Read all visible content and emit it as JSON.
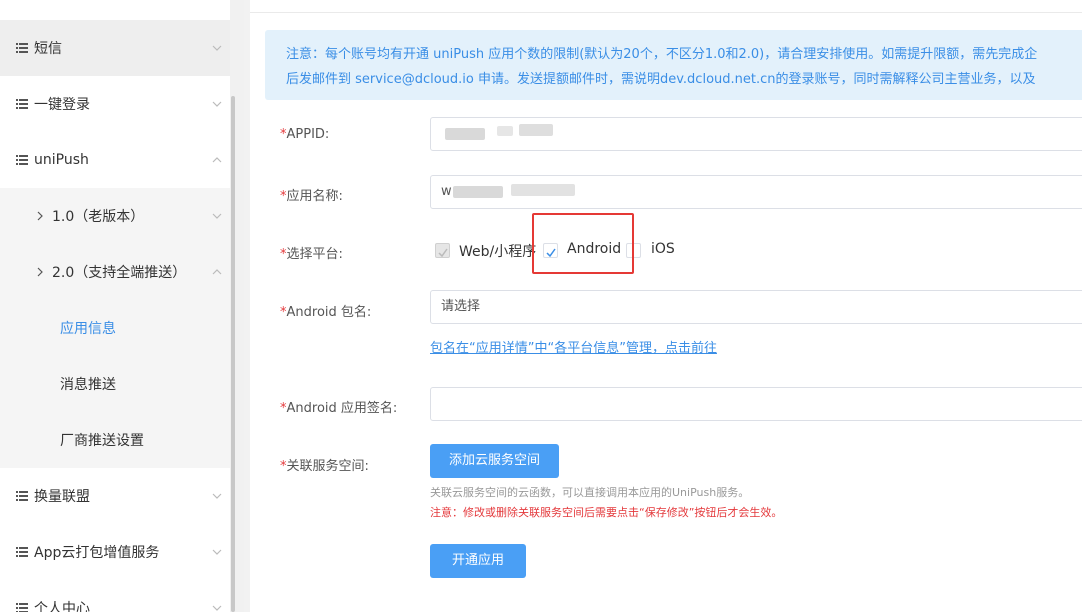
{
  "sidebar": {
    "items": [
      {
        "label": "短信",
        "expanded": false
      },
      {
        "label": "一键登录",
        "expanded": false
      },
      {
        "label": "uniPush",
        "expanded": true
      },
      {
        "label": "1.0（老版本）",
        "expanded": false
      },
      {
        "label": "2.0（支持全端推送）",
        "expanded": true
      },
      {
        "label": "应用信息",
        "active": true
      },
      {
        "label": "消息推送"
      },
      {
        "label": "厂商推送设置"
      },
      {
        "label": "换量联盟",
        "expanded": false
      },
      {
        "label": "App云打包增值服务",
        "expanded": false
      },
      {
        "label": "个人中心",
        "expanded": false
      }
    ]
  },
  "notice": {
    "line1": "注意：每个账号均有开通 uniPush 应用个数的限制(默认为20个，不区分1.0和2.0)，请合理安排使用。如需提升限额，需先完成企",
    "line2": "后发邮件到 service@dcloud.io 申请。发送提额邮件时，需说明dev.dcloud.net.cn的登录账号，同时需解释公司主营业务，以及"
  },
  "form": {
    "appid": {
      "label": "APPID:",
      "value": ""
    },
    "app_name": {
      "label": "应用名称:",
      "value": "w"
    },
    "platform": {
      "label": "选择平台:",
      "options": [
        {
          "label": "Web/小程序",
          "checked": true,
          "disabled": true
        },
        {
          "label": "Android",
          "checked": true,
          "disabled": false
        },
        {
          "label": "iOS",
          "checked": false,
          "disabled": false
        }
      ]
    },
    "android_package": {
      "label": "Android 包名:",
      "placeholder": "请选择"
    },
    "package_link": "包名在“应用详情”中“各平台信息”管理，点击前往",
    "android_signature": {
      "label": "Android 应用签名:",
      "value": ""
    },
    "service_space": {
      "label": "关联服务空间:",
      "button": "添加云服务空间",
      "hint": "关联云服务空间的云函数，可以直接调用本应用的UniPush服务。",
      "warning": "注意：修改或删除关联服务空间后需要点击“保存修改”按钮后才会生效。"
    },
    "submit": "开通应用"
  },
  "colors": {
    "accent": "#3a8ee6",
    "button": "#4a9ff5",
    "required": "#e4393c",
    "highlight": "#e53935",
    "notice_bg": "#e3f1fb"
  }
}
